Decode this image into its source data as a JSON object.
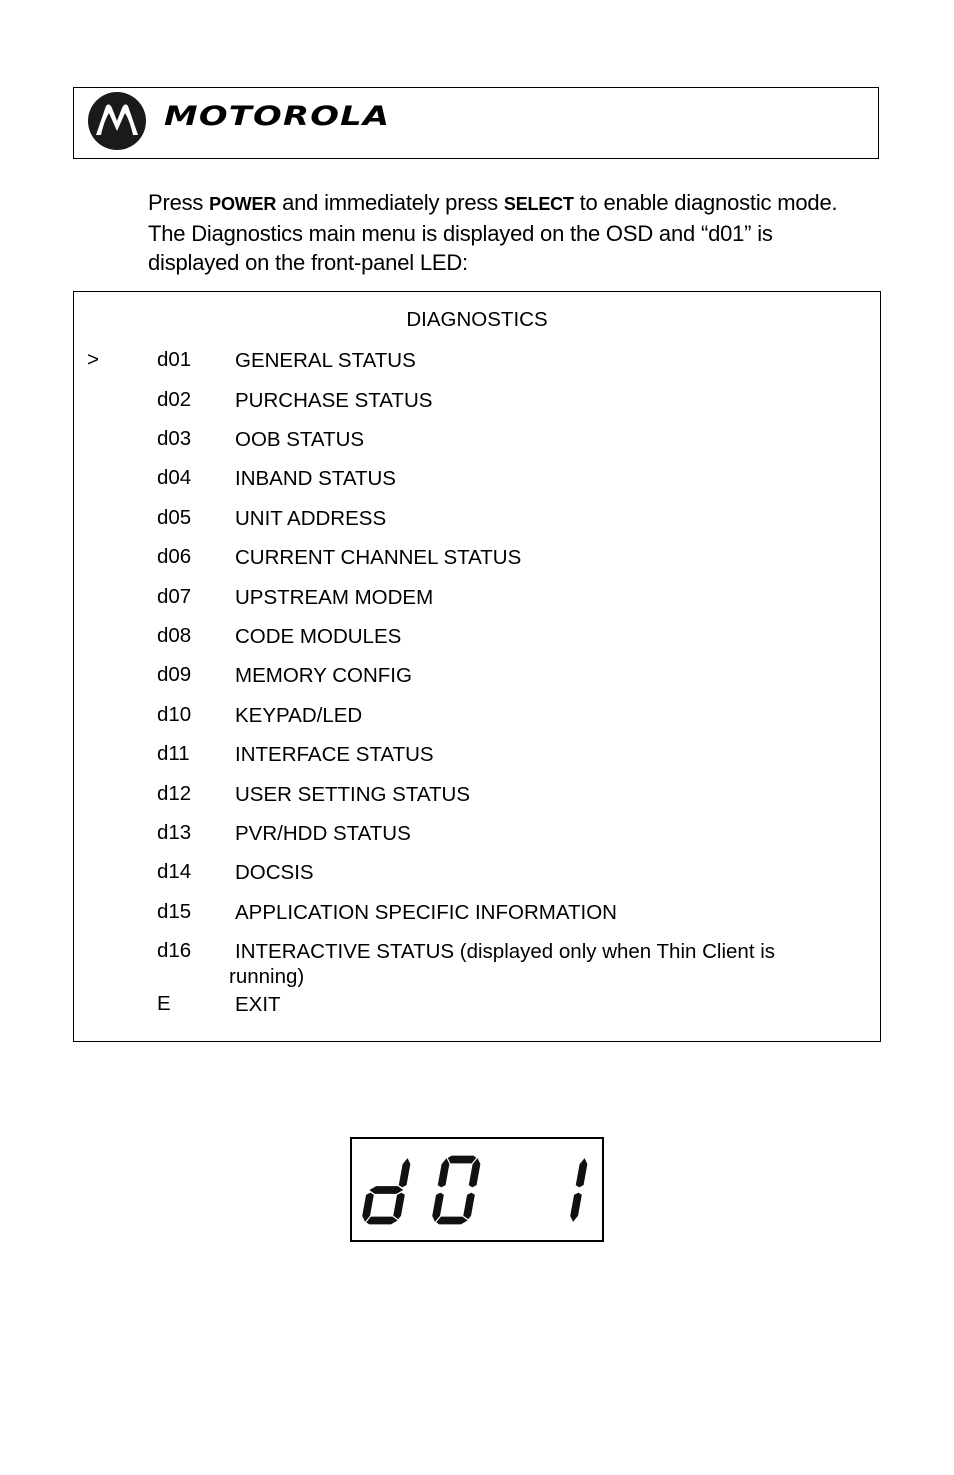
{
  "header": {
    "brand": "MOTOROLA",
    "logo_icon": "motorola-batwing-logo"
  },
  "intro": {
    "part1": "Press ",
    "key1": "POWER",
    "part2": " and immediately press ",
    "key2": "SELECT",
    "part3": " to enable diagnostic mode. The Diagnostics main menu is displayed on the OSD and “d01” is displayed on the front-panel LED:"
  },
  "menu": {
    "title": "DIAGNOSTICS",
    "cursor": ">",
    "selected_index": 0,
    "items": [
      {
        "code": "d01",
        "label": "GENERAL STATUS"
      },
      {
        "code": "d02",
        "label": "PURCHASE STATUS"
      },
      {
        "code": "d03",
        "label": "OOB STATUS"
      },
      {
        "code": "d04",
        "label": "INBAND STATUS"
      },
      {
        "code": "d05",
        "label": "UNIT ADDRESS"
      },
      {
        "code": "d06",
        "label": "CURRENT CHANNEL STATUS"
      },
      {
        "code": "d07",
        "label": "UPSTREAM MODEM"
      },
      {
        "code": "d08",
        "label": "CODE MODULES"
      },
      {
        "code": "d09",
        "label": "MEMORY CONFIG"
      },
      {
        "code": "d10",
        "label": "KEYPAD/LED"
      },
      {
        "code": "d11",
        "label": "INTERFACE STATUS"
      },
      {
        "code": "d12",
        "label": "USER SETTING STATUS"
      },
      {
        "code": "d13",
        "label": "PVR/HDD STATUS"
      },
      {
        "code": "d14",
        "label": "DOCSIS"
      },
      {
        "code": "d15",
        "label": "APPLICATION SPECIFIC INFORMATION"
      },
      {
        "code": "d16",
        "label": "INTERACTIVE STATUS (displayed only when Thin Client is",
        "label_cont": "running)"
      },
      {
        "code": "E",
        "label": "EXIT"
      }
    ]
  },
  "led_display": {
    "text": "d01",
    "digits": [
      "d",
      "0",
      "",
      "1"
    ]
  }
}
